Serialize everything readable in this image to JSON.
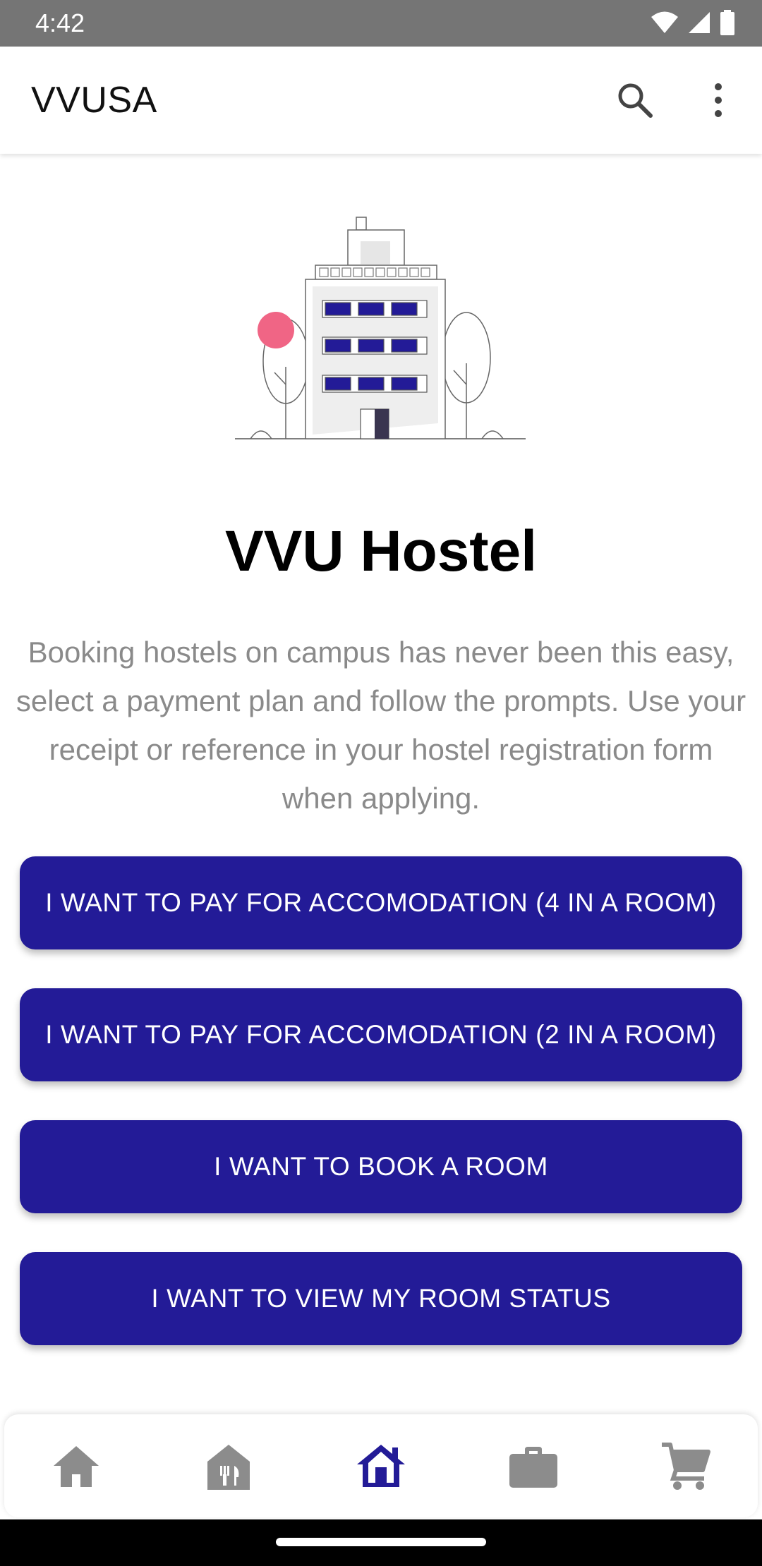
{
  "status_bar": {
    "time": "4:42"
  },
  "app_bar": {
    "title": "VVUSA",
    "search_icon": "search-icon",
    "more_icon": "more-vert-icon"
  },
  "hero": {
    "title": "VVU Hostel",
    "description": "Booking hostels on campus has never been this easy, select a payment plan and follow the prompts. Use your receipt or reference in your hostel registration form when applying."
  },
  "buttons": [
    {
      "label": "I WANT TO PAY FOR ACCOMODATION (4 IN A ROOM)"
    },
    {
      "label": "I WANT TO PAY FOR ACCOMODATION (2 IN A ROOM)"
    },
    {
      "label": "I WANT TO BOOK A ROOM"
    },
    {
      "label": "I WANT TO VIEW MY ROOM STATUS"
    }
  ],
  "bottom_nav": {
    "items": [
      {
        "icon": "home-icon",
        "active": false
      },
      {
        "icon": "restaurant-house-icon",
        "active": false
      },
      {
        "icon": "house-icon",
        "active": true
      },
      {
        "icon": "briefcase-icon",
        "active": false
      },
      {
        "icon": "cart-icon",
        "active": false
      }
    ]
  },
  "colors": {
    "accent": "#231b97",
    "status_bar": "#757575",
    "inactive_icon": "#8c8c8c",
    "pink": "#f06585"
  }
}
